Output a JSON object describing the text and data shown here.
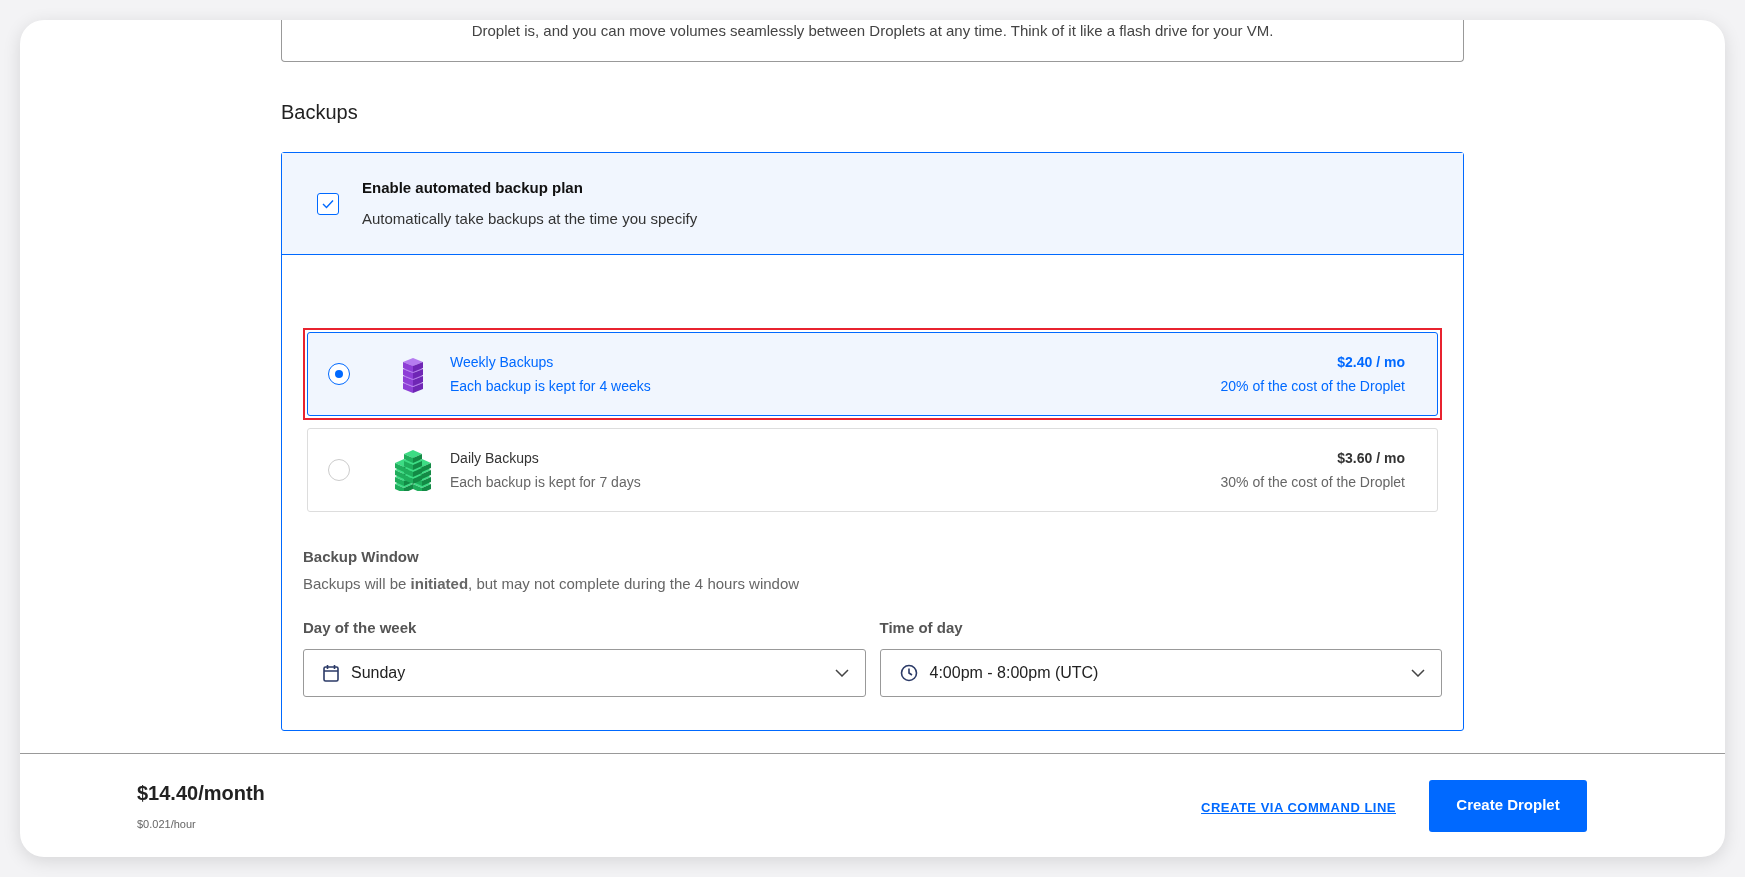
{
  "intro_box": {
    "text": "Droplet is, and you can move volumes seamlessly between Droplets at any time. Think of it like a flash drive for your VM."
  },
  "section_title": "Backups",
  "backup_option": {
    "title": "Enable automated backup plan",
    "description": "Automatically take backups at the time you specify",
    "checked": true
  },
  "plans": [
    {
      "kind": "weekly",
      "name": "Weekly Backups",
      "description": "Each backup is kept for 4 weeks",
      "price": "$2.40 / mo",
      "share": "20% of the cost of the Droplet",
      "selected": true,
      "highlighted": true
    },
    {
      "kind": "daily",
      "name": "Daily Backups",
      "description": "Each backup is kept for 7 days",
      "price": "$3.60 / mo",
      "share": "30% of the cost of the Droplet",
      "selected": false,
      "highlighted": false
    }
  ],
  "backup_window": {
    "title": "Backup Window",
    "note": "Backups will be **initiated**, but may not complete during the 4 hours window",
    "fields": [
      {
        "kind": "day",
        "label": "Day of the week",
        "value": "Sunday"
      },
      {
        "kind": "time",
        "label": "Time of day",
        "value": "4:00pm - 8:00pm (UTC)"
      }
    ]
  },
  "footer": {
    "price": "$14.40/month",
    "hourly": "$0.021/hour",
    "link": "CREATE VIA COMMAND LINE",
    "button": "Create Droplet"
  }
}
